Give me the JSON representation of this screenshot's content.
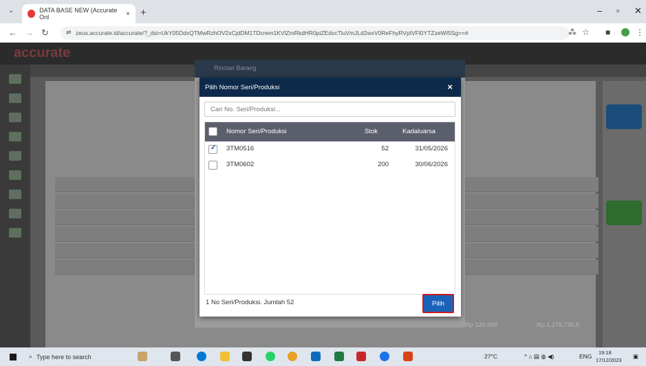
{
  "browser": {
    "tab_title": "DATA BASE NEW (Accurate Onl",
    "tab_close": "×",
    "new_tab": "+",
    "url": "zeus.accurate.id/accurate/?_dsi=UkY05DdxQTMwRzhOV2xCjdDM1TDcrem1KVlZmRkdHR0piZEdvcTluVmJLd2wxV0ReFhyRVpIVFl0YTZzeWI5Sg==#",
    "window_controls": [
      "–",
      "▫",
      "✕"
    ]
  },
  "app": {
    "logo_text": "accurate",
    "background_modal_title": "Rincian Barang",
    "background_total_left": "Rp 120.000",
    "background_total_right": "Rp 1.278.730,5"
  },
  "modal": {
    "title": "Pilih Nomor Seri/Produksi",
    "close": "×",
    "search_placeholder": "Cari No. Seri/Produksi...",
    "columns": {
      "serial": "Nomor Seri/Produksi",
      "stock": "Stok",
      "expiry": "Kadaluarsa"
    },
    "rows": [
      {
        "serial": "3TM0516",
        "stock": "52",
        "expiry": "31/05/2026",
        "checked": true
      },
      {
        "serial": "3TM0602",
        "stock": "200",
        "expiry": "30/06/2026",
        "checked": false
      }
    ],
    "footer_text": "1 No Seri/Produksi. Jumlah 52",
    "select_button": "Pilih"
  },
  "taskbar": {
    "search_placeholder": "Type here to search",
    "weather": "27°C",
    "language": "ENG",
    "time": "19:18",
    "date": "17/12/2023"
  },
  "colors": {
    "modal_header": "#0e2a4a",
    "grid_header": "#5b5f6b",
    "primary_button": "#1a63b8",
    "highlight_border": "#d01a1a"
  }
}
